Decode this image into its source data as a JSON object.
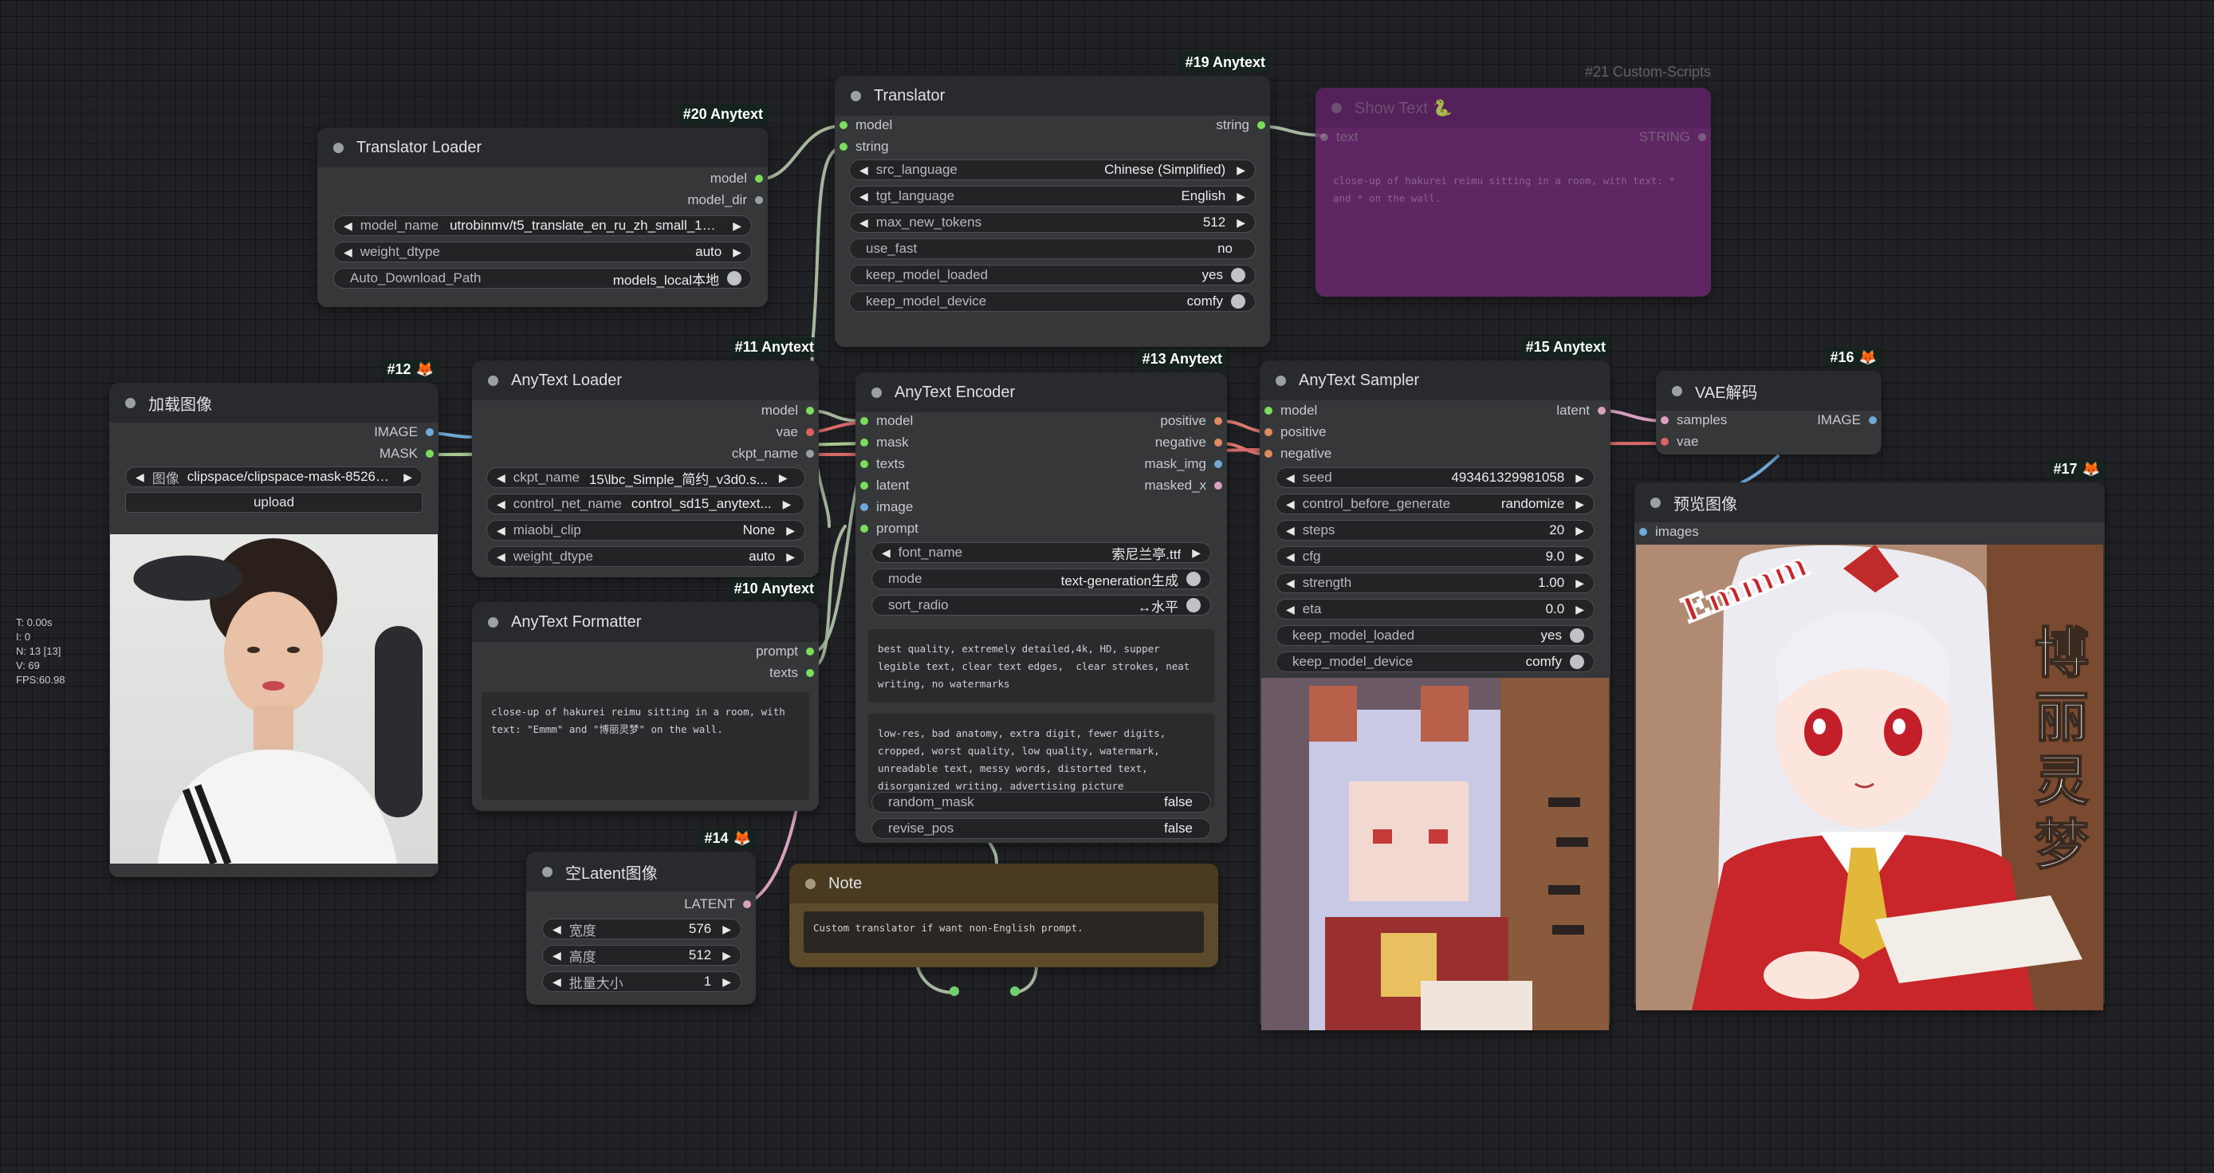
{
  "stats": {
    "time": "T: 0.00s",
    "i": "I: 0",
    "n": "N: 13 [13]",
    "v": "V: 69",
    "fps": "FPS:60.98"
  },
  "colors": {
    "bg": "#202124",
    "node": "#353739",
    "header": "#282a2d",
    "purple_node": "#6a2870",
    "note_node": "#5c4a2a"
  },
  "nodes": {
    "translator_loader": {
      "badge": "#20 Anytext",
      "title": "Translator Loader",
      "outputs": [
        "model",
        "model_dir"
      ],
      "widgets": [
        {
          "label": "model_name",
          "value": "utrobinmv/t5_translate_en_ru_zh_small_1024"
        },
        {
          "label": "weight_dtype",
          "value": "auto"
        },
        {
          "label": "Auto_Download_Path",
          "value": "models_local本地"
        }
      ]
    },
    "translator": {
      "badge": "#19 Anytext",
      "title": "Translator",
      "inputs": [
        "model",
        "string"
      ],
      "output": "string",
      "widgets": [
        {
          "label": "src_language",
          "value": "Chinese (Simplified)"
        },
        {
          "label": "tgt_language",
          "value": "English"
        },
        {
          "label": "max_new_tokens",
          "value": "512"
        },
        {
          "label": "use_fast",
          "value": "no"
        },
        {
          "label": "keep_model_loaded",
          "value": "yes"
        },
        {
          "label": "keep_model_device",
          "value": "comfy"
        }
      ]
    },
    "show_text": {
      "badge": "#21 Custom-Scripts",
      "title": "Show Text 🐍",
      "input": "text",
      "output": "STRING",
      "content": "close-up of hakurei reimu sitting in a room, with text: * and * on the wall."
    },
    "load_image": {
      "badge": "#12",
      "title": "加载图像",
      "outputs": [
        "IMAGE",
        "MASK"
      ],
      "image_widget": {
        "label": "图像",
        "value": "clipspace/clipspace-mask-85261..."
      },
      "upload": "upload"
    },
    "anytext_loader": {
      "badge": "#11 Anytext",
      "title": "AnyText Loader",
      "outputs": [
        "model",
        "vae",
        "ckpt_name"
      ],
      "widgets": [
        {
          "label": "ckpt_name",
          "value": "15\\lbc_Simple_简约_v3d0.s..."
        },
        {
          "label": "control_net_name",
          "value": "control_sd15_anytext..."
        },
        {
          "label": "miaobi_clip",
          "value": "None"
        },
        {
          "label": "weight_dtype",
          "value": "auto"
        }
      ]
    },
    "anytext_formatter": {
      "badge": "#10 Anytext",
      "title": "AnyText Formatter",
      "outputs": [
        "prompt",
        "texts"
      ],
      "content": "close-up of hakurei reimu sitting in a room, with text: \"Emmm\" and \"博丽灵梦\" on the wall."
    },
    "anytext_encoder": {
      "badge": "#13 Anytext",
      "title": "AnyText Encoder",
      "inputs": [
        "model",
        "mask",
        "texts",
        "latent",
        "image",
        "prompt"
      ],
      "outputs": [
        "positive",
        "negative",
        "mask_img",
        "masked_x"
      ],
      "widgets": [
        {
          "label": "font_name",
          "value": "索尼兰亭.ttf"
        },
        {
          "label": "mode",
          "value": "text-generation生成"
        },
        {
          "label": "sort_radio",
          "value": "↔水平"
        }
      ],
      "positive_text": "best quality, extremely detailed,4k, HD, supper legible text, clear text edges,  clear strokes, neat writing, no watermarks",
      "negative_text": "low-res, bad anatomy, extra digit, fewer digits, cropped, worst quality, low quality, watermark, unreadable text, messy words, distorted text, disorganized writing, advertising picture",
      "bottom_widgets": [
        {
          "label": "random_mask",
          "value": "false"
        },
        {
          "label": "revise_pos",
          "value": "false"
        }
      ]
    },
    "anytext_sampler": {
      "badge": "#15 Anytext",
      "title": "AnyText Sampler",
      "inputs": [
        "model",
        "positive",
        "negative"
      ],
      "output": "latent",
      "widgets": [
        {
          "label": "seed",
          "value": "493461329981058"
        },
        {
          "label": "control_before_generate",
          "value": "randomize"
        },
        {
          "label": "steps",
          "value": "20"
        },
        {
          "label": "cfg",
          "value": "9.0"
        },
        {
          "label": "strength",
          "value": "1.00"
        },
        {
          "label": "eta",
          "value": "0.0"
        },
        {
          "label": "keep_model_loaded",
          "value": "yes"
        },
        {
          "label": "keep_model_device",
          "value": "comfy"
        }
      ]
    },
    "vae_decode": {
      "badge": "#16",
      "title": "VAE解码",
      "inputs": [
        "samples",
        "vae"
      ],
      "output": "IMAGE"
    },
    "preview_image": {
      "badge": "#17",
      "title": "预览图像",
      "input": "images",
      "text_emmm": "Emmm",
      "text_reimu": "博丽灵梦"
    },
    "empty_latent": {
      "badge": "#14",
      "title": "空Latent图像",
      "output": "LATENT",
      "widgets": [
        {
          "label": "宽度",
          "value": "576"
        },
        {
          "label": "高度",
          "value": "512"
        },
        {
          "label": "批量大小",
          "value": "1"
        }
      ]
    },
    "note": {
      "title": "Note",
      "content": "Custom translator if want non-English prompt."
    }
  },
  "pixel_art_text": "博丽灵梦"
}
